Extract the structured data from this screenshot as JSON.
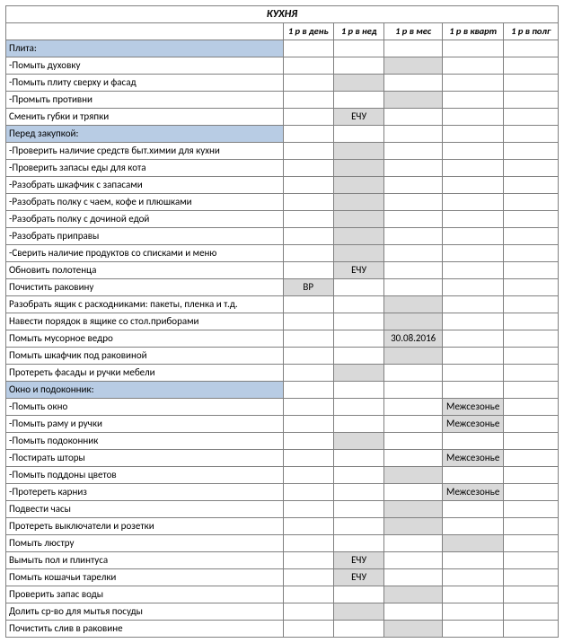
{
  "title": "КУХНЯ",
  "columns": [
    "1 р в день",
    "1 р в нед",
    "1 р в мес",
    "1 р в кварт",
    "1 р в полг"
  ],
  "rows": [
    {
      "type": "section",
      "task": "Плита:",
      "cells": [
        "",
        "",
        "",
        "",
        ""
      ],
      "shade": [
        false,
        false,
        false,
        false,
        false
      ]
    },
    {
      "type": "item",
      "task": "-Помыть духовку",
      "cells": [
        "",
        "",
        "",
        "",
        ""
      ],
      "shade": [
        false,
        false,
        true,
        false,
        false
      ]
    },
    {
      "type": "item",
      "task": "-Помыть плиту сверху и фасад",
      "cells": [
        "",
        "",
        "",
        "",
        ""
      ],
      "shade": [
        false,
        true,
        false,
        false,
        false
      ]
    },
    {
      "type": "item",
      "task": "-Промыть противни",
      "cells": [
        "",
        "",
        "",
        "",
        ""
      ],
      "shade": [
        false,
        false,
        true,
        false,
        false
      ]
    },
    {
      "type": "item",
      "task": "Сменить губки и тряпки",
      "cells": [
        "",
        "ЕЧУ",
        "",
        "",
        ""
      ],
      "shade": [
        false,
        true,
        false,
        false,
        false
      ]
    },
    {
      "type": "section",
      "task": "Перед закупкой:",
      "cells": [
        "",
        "",
        "",
        "",
        ""
      ],
      "shade": [
        false,
        false,
        false,
        false,
        false
      ]
    },
    {
      "type": "item",
      "task": "-Проверить наличие средств быт.химии для кухни",
      "cells": [
        "",
        "",
        "",
        "",
        ""
      ],
      "shade": [
        false,
        true,
        false,
        false,
        false
      ]
    },
    {
      "type": "item",
      "task": "-Проверить запасы еды для кота",
      "cells": [
        "",
        "",
        "",
        "",
        ""
      ],
      "shade": [
        false,
        true,
        false,
        false,
        false
      ]
    },
    {
      "type": "item",
      "task": "-Разобрать шкафчик с запасами",
      "cells": [
        "",
        "",
        "",
        "",
        ""
      ],
      "shade": [
        false,
        true,
        false,
        false,
        false
      ]
    },
    {
      "type": "item",
      "task": "-Разобрать полку с чаем, кофе и плюшками",
      "cells": [
        "",
        "",
        "",
        "",
        ""
      ],
      "shade": [
        false,
        true,
        false,
        false,
        false
      ]
    },
    {
      "type": "item",
      "task": "-Разобрать полку с дочиной едой",
      "cells": [
        "",
        "",
        "",
        "",
        ""
      ],
      "shade": [
        false,
        true,
        false,
        false,
        false
      ]
    },
    {
      "type": "item",
      "task": "-Разобрать приправы",
      "cells": [
        "",
        "",
        "",
        "",
        ""
      ],
      "shade": [
        false,
        true,
        false,
        false,
        false
      ]
    },
    {
      "type": "item",
      "task": "-Сверить наличие продуктов со списками и меню",
      "cells": [
        "",
        "",
        "",
        "",
        ""
      ],
      "shade": [
        false,
        true,
        false,
        false,
        false
      ]
    },
    {
      "type": "item",
      "task": "Обновить полотенца",
      "cells": [
        "",
        "ЕЧУ",
        "",
        "",
        ""
      ],
      "shade": [
        false,
        true,
        false,
        false,
        false
      ]
    },
    {
      "type": "item",
      "task": "Почистить раковину",
      "cells": [
        "ВР",
        "",
        "",
        "",
        ""
      ],
      "shade": [
        true,
        false,
        false,
        false,
        false
      ]
    },
    {
      "type": "item",
      "task": "Разобрать ящик с расходниками: пакеты, пленка и т.д.",
      "cells": [
        "",
        "",
        "",
        "",
        ""
      ],
      "shade": [
        false,
        false,
        true,
        false,
        false
      ]
    },
    {
      "type": "item",
      "task": "Навести порядок в ящике со стол.приборами",
      "cells": [
        "",
        "",
        "",
        "",
        ""
      ],
      "shade": [
        false,
        false,
        true,
        false,
        false
      ]
    },
    {
      "type": "item",
      "task": "Помыть мусорное ведро",
      "cells": [
        "",
        "",
        "30.08.2016",
        "",
        ""
      ],
      "shade": [
        false,
        false,
        true,
        false,
        false
      ]
    },
    {
      "type": "item",
      "task": "Помыть шкафчик под раковиной",
      "cells": [
        "",
        "",
        "",
        "",
        ""
      ],
      "shade": [
        false,
        false,
        true,
        false,
        false
      ]
    },
    {
      "type": "item",
      "task": "Протереть фасады и ручки мебели",
      "cells": [
        "",
        "",
        "",
        "",
        ""
      ],
      "shade": [
        false,
        true,
        false,
        false,
        false
      ]
    },
    {
      "type": "section",
      "task": "Окно и подоконник:",
      "cells": [
        "",
        "",
        "",
        "",
        ""
      ],
      "shade": [
        false,
        false,
        false,
        false,
        false
      ]
    },
    {
      "type": "item",
      "task": "-Помыть окно",
      "cells": [
        "",
        "",
        "",
        "Межсезонье",
        ""
      ],
      "shade": [
        false,
        false,
        false,
        true,
        false
      ]
    },
    {
      "type": "item",
      "task": "-Помыть раму и ручки",
      "cells": [
        "",
        "",
        "",
        "Межсезонье",
        ""
      ],
      "shade": [
        false,
        false,
        false,
        true,
        false
      ]
    },
    {
      "type": "item",
      "task": "-Помыть подоконник",
      "cells": [
        "",
        "",
        "",
        "",
        ""
      ],
      "shade": [
        false,
        true,
        false,
        false,
        false
      ]
    },
    {
      "type": "item",
      "task": "-Постирать шторы",
      "cells": [
        "",
        "",
        "",
        "Межсезонье",
        ""
      ],
      "shade": [
        false,
        false,
        false,
        true,
        false
      ]
    },
    {
      "type": "item",
      "task": "-Помыть поддоны цветов",
      "cells": [
        "",
        "",
        "",
        "",
        ""
      ],
      "shade": [
        false,
        false,
        true,
        false,
        false
      ]
    },
    {
      "type": "item",
      "task": "-Протереть карниз",
      "cells": [
        "",
        "",
        "",
        "Межсезонье",
        ""
      ],
      "shade": [
        false,
        false,
        false,
        true,
        false
      ]
    },
    {
      "type": "item",
      "task": "Подвести часы",
      "cells": [
        "",
        "",
        "",
        "",
        ""
      ],
      "shade": [
        false,
        false,
        true,
        false,
        false
      ]
    },
    {
      "type": "item",
      "task": "Протереть выключатели и розетки",
      "cells": [
        "",
        "",
        "",
        "",
        ""
      ],
      "shade": [
        false,
        false,
        true,
        false,
        false
      ]
    },
    {
      "type": "item",
      "task": "Помыть люстру",
      "cells": [
        "",
        "",
        "",
        "",
        ""
      ],
      "shade": [
        false,
        false,
        false,
        true,
        false
      ]
    },
    {
      "type": "item",
      "task": "Вымыть пол и плинтуса",
      "cells": [
        "",
        "ЕЧУ",
        "",
        "",
        ""
      ],
      "shade": [
        false,
        true,
        false,
        false,
        false
      ]
    },
    {
      "type": "item",
      "task": "Помыть кошачьи тарелки",
      "cells": [
        "",
        "ЕЧУ",
        "",
        "",
        ""
      ],
      "shade": [
        false,
        true,
        false,
        false,
        false
      ]
    },
    {
      "type": "item",
      "task": "Проверить запас воды",
      "cells": [
        "",
        "",
        "",
        "",
        ""
      ],
      "shade": [
        false,
        false,
        true,
        false,
        false
      ]
    },
    {
      "type": "item",
      "task": "Долить ср-во для мытья посуды",
      "cells": [
        "",
        "",
        "",
        "",
        ""
      ],
      "shade": [
        false,
        true,
        false,
        false,
        false
      ]
    },
    {
      "type": "item",
      "task": "Почистить слив в раковине",
      "cells": [
        "",
        "",
        "",
        "",
        ""
      ],
      "shade": [
        false,
        false,
        true,
        false,
        false
      ]
    }
  ]
}
